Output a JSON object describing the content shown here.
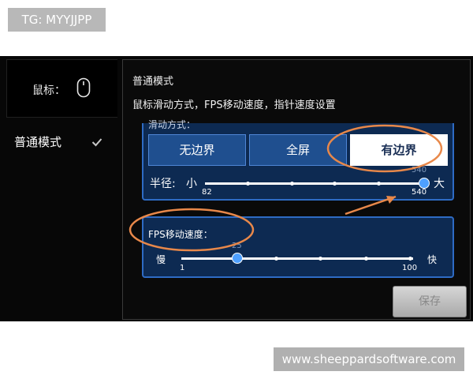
{
  "watermarks": {
    "top": "TG: MYYJJPP",
    "bottom": "www.sheeppardsoftware.com"
  },
  "sidebar": {
    "mouse_label": "鼠标：",
    "mouse_icon": "mouse-icon",
    "items": [
      {
        "label": "普通模式",
        "selected": true,
        "icon": "check-icon"
      }
    ]
  },
  "panel": {
    "title": "普通模式",
    "subtitle": "鼠标滑动方式，FPS移动速度，指针速度设置",
    "slide_section_label_partial": "滑动方式：",
    "boundary_options": [
      "无边界",
      "全屏",
      "有边界"
    ],
    "selected_boundary": "有边界",
    "radius": {
      "label": "半径:",
      "min_label": "小",
      "max_label": "大",
      "min": "82",
      "max": "540",
      "current": "540",
      "value_fraction": 1.0
    },
    "fps": {
      "label": "FPS移动速度：",
      "min_label": "慢",
      "max_label": "快",
      "min": "1",
      "max": "100",
      "current": "25",
      "value_fraction": 0.24
    },
    "save_label": "保存"
  },
  "colors": {
    "panel_blue": "#0d2a52",
    "border_blue": "#2e6bc4",
    "thumb_blue": "#4ea0ff",
    "annotation_orange": "#e8884a",
    "selected_button_bg": "#ffffff"
  }
}
